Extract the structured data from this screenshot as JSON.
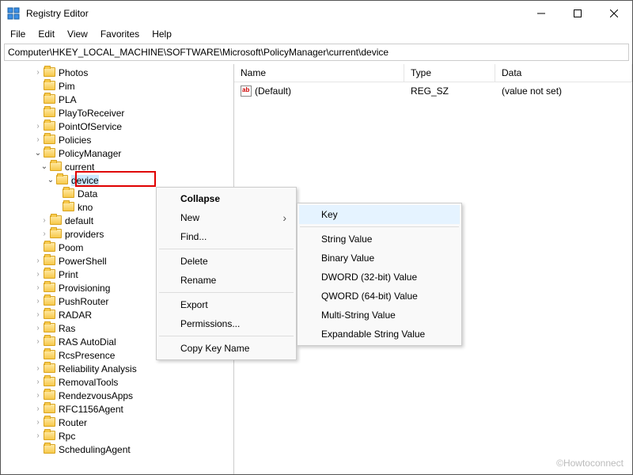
{
  "window": {
    "title": "Registry Editor"
  },
  "menubar": [
    "File",
    "Edit",
    "View",
    "Favorites",
    "Help"
  ],
  "addressbar": "Computer\\HKEY_LOCAL_MACHINE\\SOFTWARE\\Microsoft\\PolicyManager\\current\\device",
  "tree": {
    "items": [
      {
        "indent": 5,
        "chev": ">",
        "label": "Photos"
      },
      {
        "indent": 5,
        "chev": "",
        "label": "Pim"
      },
      {
        "indent": 5,
        "chev": "",
        "label": "PLA"
      },
      {
        "indent": 5,
        "chev": "",
        "label": "PlayToReceiver"
      },
      {
        "indent": 5,
        "chev": ">",
        "label": "PointOfService"
      },
      {
        "indent": 5,
        "chev": ">",
        "label": "Policies"
      },
      {
        "indent": 5,
        "chev": "v",
        "label": "PolicyManager"
      },
      {
        "indent": 6,
        "chev": "v",
        "label": "current"
      },
      {
        "indent": 7,
        "chev": "v",
        "label": "device",
        "highlighted": true
      },
      {
        "indent": 8,
        "chev": "",
        "label": "Data"
      },
      {
        "indent": 8,
        "chev": "",
        "label": "kno"
      },
      {
        "indent": 6,
        "chev": ">",
        "label": "default"
      },
      {
        "indent": 6,
        "chev": ">",
        "label": "providers"
      },
      {
        "indent": 5,
        "chev": "",
        "label": "Poom"
      },
      {
        "indent": 5,
        "chev": ">",
        "label": "PowerShell"
      },
      {
        "indent": 5,
        "chev": ">",
        "label": "Print"
      },
      {
        "indent": 5,
        "chev": ">",
        "label": "Provisioning"
      },
      {
        "indent": 5,
        "chev": ">",
        "label": "PushRouter"
      },
      {
        "indent": 5,
        "chev": ">",
        "label": "RADAR"
      },
      {
        "indent": 5,
        "chev": ">",
        "label": "Ras"
      },
      {
        "indent": 5,
        "chev": ">",
        "label": "RAS AutoDial"
      },
      {
        "indent": 5,
        "chev": "",
        "label": "RcsPresence"
      },
      {
        "indent": 5,
        "chev": ">",
        "label": "Reliability Analysis"
      },
      {
        "indent": 5,
        "chev": ">",
        "label": "RemovalTools"
      },
      {
        "indent": 5,
        "chev": ">",
        "label": "RendezvousApps"
      },
      {
        "indent": 5,
        "chev": ">",
        "label": "RFC1156Agent"
      },
      {
        "indent": 5,
        "chev": ">",
        "label": "Router"
      },
      {
        "indent": 5,
        "chev": ">",
        "label": "Rpc"
      },
      {
        "indent": 5,
        "chev": "",
        "label": "SchedulingAgent"
      }
    ]
  },
  "list": {
    "headers": {
      "name": "Name",
      "type": "Type",
      "data": "Data"
    },
    "rows": [
      {
        "name": "(Default)",
        "type": "REG_SZ",
        "data": "(value not set)"
      }
    ]
  },
  "contextMenu1": {
    "collapse": "Collapse",
    "new": "New",
    "find": "Find...",
    "delete": "Delete",
    "rename": "Rename",
    "export": "Export",
    "permissions": "Permissions...",
    "copykey": "Copy Key Name"
  },
  "contextMenu2": {
    "key": "Key",
    "string": "String Value",
    "binary": "Binary Value",
    "dword": "DWORD (32-bit) Value",
    "qword": "QWORD (64-bit) Value",
    "multistring": "Multi-String Value",
    "expandable": "Expandable String Value"
  },
  "watermark": "©Howtoconnect"
}
